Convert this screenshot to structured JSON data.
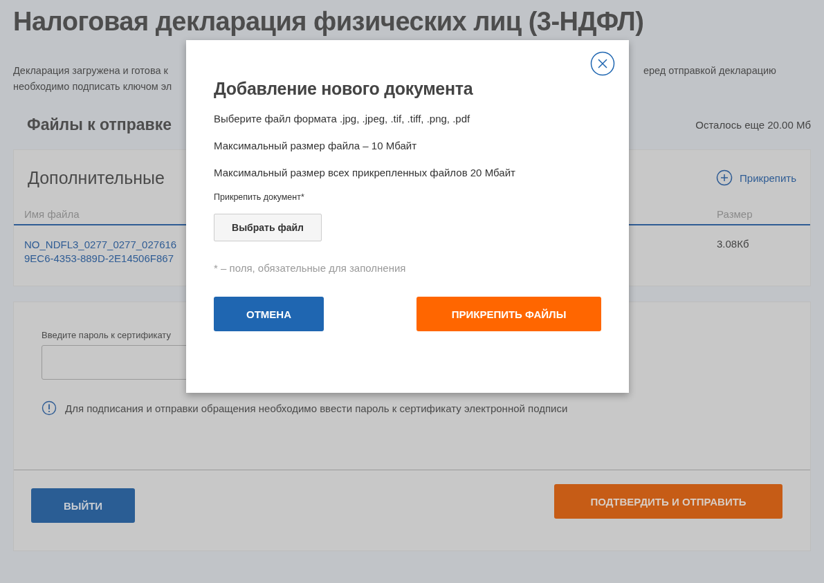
{
  "page": {
    "title": "Налоговая декларация физических лиц (3-НДФЛ)",
    "intro_left": [
      "Декларация загружена и готова к",
      "необходимо подписать ключом эл"
    ],
    "intro_right": "еред отправкой декларацию",
    "files_heading": "Файлы к отправке",
    "quota": "Осталось еще 20.00 Мб"
  },
  "attachments": {
    "title": "Дополнительные",
    "attach_link": "Прикрепить",
    "columns": [
      "Имя файла",
      "Размер"
    ],
    "rows": [
      {
        "name_lines": [
          "NO_NDFL3_0277_0277_027616",
          "9EC6-4353-889D-2E14506F867"
        ],
        "size": "3.08Кб"
      }
    ]
  },
  "signing": {
    "password_label": "Введите пароль к сертификату",
    "notice": "Для подписания и отправки обращения необходимо ввести пароль к сертификату электронной подписи",
    "exit_button": "ВЫЙТИ",
    "submit_button": "ПОДТВЕРДИТЬ И ОТПРАВИТЬ"
  },
  "dialog": {
    "title": "Добавление нового документа",
    "lines": [
      "Выберите файл формата .jpg, .jpeg, .tif, .tiff, .png, .pdf",
      "Максимальный размер файла – 10 Мбайт",
      "Максимальный размер всех прикрепленных файлов 20 Мбайт"
    ],
    "field_label": "Прикрепить документ*",
    "choose_button": "Выбрать файл",
    "required_note": "* – поля, обязательные для заполнения",
    "cancel_button": "ОТМЕНА",
    "confirm_button": "ПРИКРЕПИТЬ ФАЙЛЫ"
  }
}
